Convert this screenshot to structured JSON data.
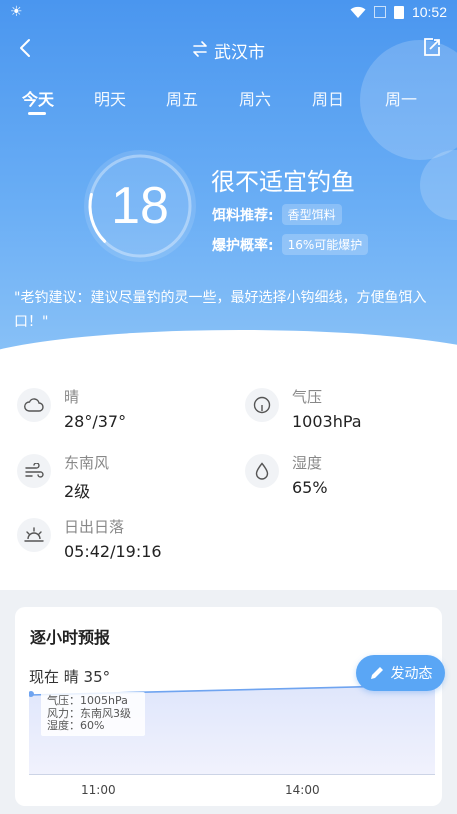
{
  "status_bar": {
    "time": "10:52"
  },
  "nav": {
    "city_icon": "swap-icon",
    "city": "武汉市"
  },
  "tabs": [
    {
      "label": "今天",
      "active": true
    },
    {
      "label": "明天"
    },
    {
      "label": "周五"
    },
    {
      "label": "周六"
    },
    {
      "label": "周日"
    },
    {
      "label": "周一"
    }
  ],
  "score": {
    "value": "18",
    "gauge_fraction": 0.18
  },
  "verdict": "很不适宜钓鱼",
  "bait": {
    "label": "饵料推荐:",
    "value": "香型饵料"
  },
  "catch_rate": {
    "label": "爆护概率:",
    "value": "16%可能爆护"
  },
  "advice": "\"老钓建议：建议尽量钓的灵一些，最好选择小钩细线，方便鱼饵入口！\"",
  "details": {
    "weather": {
      "label": "晴",
      "value": "28°/37°",
      "icon": "cloud-icon"
    },
    "pressure": {
      "label": "气压",
      "value": "1003hPa",
      "icon": "gauge-icon"
    },
    "wind": {
      "label": "东南风",
      "value": "2级",
      "icon": "wind-icon"
    },
    "humidity": {
      "label": "湿度",
      "value": "65%",
      "icon": "droplet-icon"
    },
    "sun": {
      "label": "日出日落",
      "value": "05:42/19:16",
      "icon": "sunrise-icon"
    }
  },
  "forecast": {
    "title": "逐小时预报",
    "now": "现在 晴 35°",
    "tooltip": {
      "pressure": "气压：1005hPa",
      "wind": "风力：东南风3级",
      "humidity": "湿度：60%"
    },
    "x_labels": [
      "11:00",
      "14:00"
    ]
  },
  "post_button": "发动态",
  "colors": {
    "accent": "#4a96ef",
    "hero_light": "#8cc3f7"
  }
}
